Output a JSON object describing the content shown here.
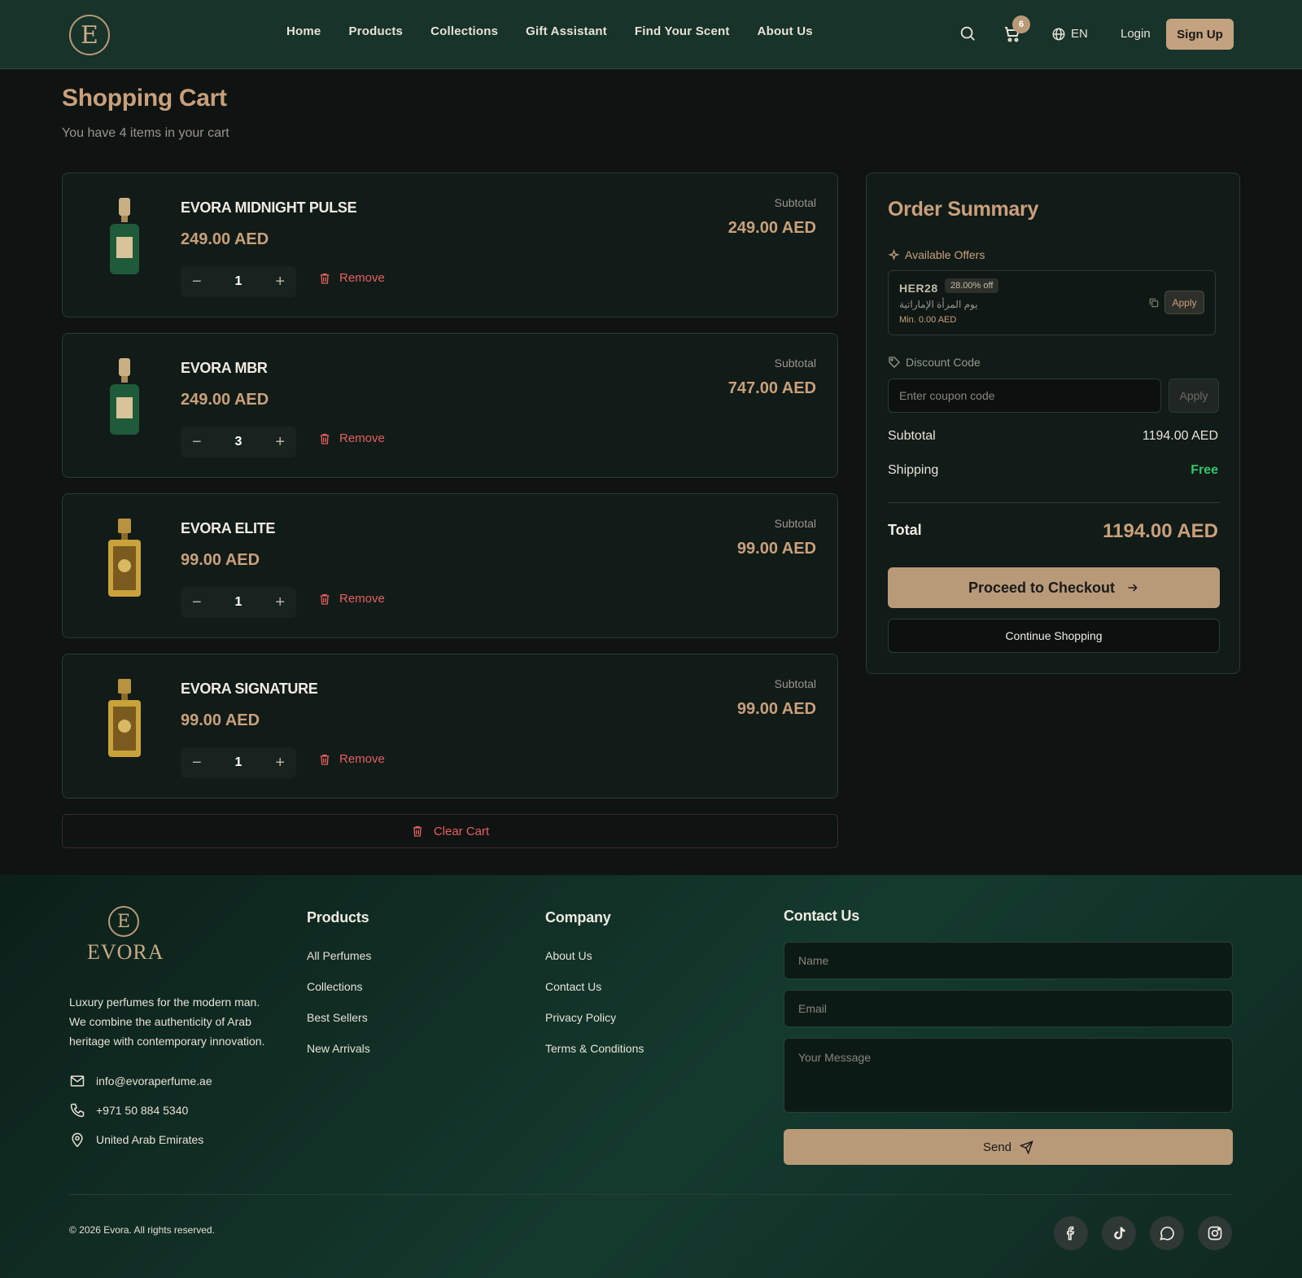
{
  "header": {
    "logo_letter": "E",
    "nav": [
      "Home",
      "Products",
      "Collections",
      "Gift Assistant",
      "Find Your Scent",
      "About Us"
    ],
    "cart_count": "6",
    "language": "EN",
    "login": "Login",
    "signup": "Sign Up"
  },
  "page": {
    "title": "Shopping Cart",
    "subtitle": "You have 4 items in your cart"
  },
  "cart": {
    "subtotal_label": "Subtotal",
    "remove_label": "Remove",
    "clear_label": "Clear Cart",
    "items": [
      {
        "name": "EVORA MIDNIGHT PULSE",
        "price": "249.00 AED",
        "qty": "1",
        "subtotal": "249.00 AED",
        "bottle": "green"
      },
      {
        "name": "EVORA MBR",
        "price": "249.00 AED",
        "qty": "3",
        "subtotal": "747.00 AED",
        "bottle": "green"
      },
      {
        "name": "EVORA ELITE",
        "price": "99.00 AED",
        "qty": "1",
        "subtotal": "99.00 AED",
        "bottle": "gold"
      },
      {
        "name": "EVORA SIGNATURE",
        "price": "99.00 AED",
        "qty": "1",
        "subtotal": "99.00 AED",
        "bottle": "gold"
      }
    ]
  },
  "summary": {
    "title": "Order Summary",
    "offers_label": "Available Offers",
    "offer": {
      "code": "HER28",
      "discount": "28.00% off",
      "description": "يوم المرأة الإماراتية",
      "minimum": "Min. 0.00 AED",
      "apply": "Apply"
    },
    "discount_label": "Discount Code",
    "coupon_placeholder": "Enter coupon code",
    "coupon_apply": "Apply",
    "subtotal_label": "Subtotal",
    "subtotal_value": "1194.00 AED",
    "shipping_label": "Shipping",
    "shipping_value": "Free",
    "total_label": "Total",
    "total_value": "1194.00 AED",
    "checkout": "Proceed to Checkout",
    "continue": "Continue Shopping"
  },
  "footer": {
    "brand": "EVORA",
    "description": "Luxury perfumes for the modern man. We combine the authenticity of Arab heritage with contemporary innovation.",
    "email": "info@evoraperfume.ae",
    "phone": "+971 50 884 5340",
    "location": "United Arab Emirates",
    "products_heading": "Products",
    "products_links": [
      "All Perfumes",
      "Collections",
      "Best Sellers",
      "New Arrivals"
    ],
    "company_heading": "Company",
    "company_links": [
      "About Us",
      "Contact Us",
      "Privacy Policy",
      "Terms & Conditions"
    ],
    "contact_heading": "Contact Us",
    "name_placeholder": "Name",
    "email_placeholder": "Email",
    "message_placeholder": "Your Message",
    "send": "Send",
    "copyright": "© 2026 Evora. All rights reserved.",
    "social": [
      "facebook-icon",
      "tiktok-icon",
      "whatsapp-icon",
      "instagram-icon"
    ]
  },
  "colors": {
    "accent": "#c9a07b",
    "header_bg": "#17332a",
    "danger": "#e46060",
    "success": "#35c46a"
  }
}
